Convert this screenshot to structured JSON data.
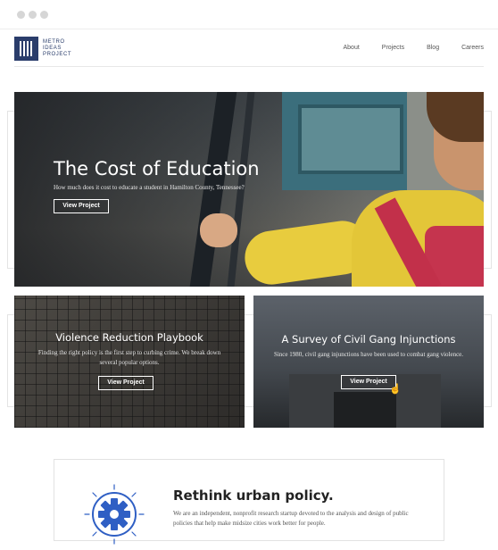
{
  "window": {
    "controls": [
      "close",
      "minimize",
      "maximize"
    ]
  },
  "logo": {
    "lines": [
      "METRO",
      "IDEAS",
      "PROJECT"
    ]
  },
  "nav": {
    "items": [
      "About",
      "Projects",
      "Blog",
      "Careers"
    ]
  },
  "hero": {
    "title": "The Cost of Education",
    "subtitle": "How much does it cost to educate a student in Hamilton County, Tennessee?",
    "button": "View Project"
  },
  "cards": [
    {
      "title": "Violence Reduction Playbook",
      "text": "Finding the right policy is the first step to curbing crime. We break down several popular options.",
      "button": "View Project"
    },
    {
      "title": "A Survey of Civil Gang Injunctions",
      "text": "Since 1980, civil gang injunctions have been used to combat gang violence.",
      "button": "View Project"
    }
  ],
  "info": {
    "icon": "gear-icon",
    "title": "Rethink urban policy.",
    "text": "We are an independent, nonprofit research startup devoted to the analysis and design of public policies that help make midsize cities work better for people."
  },
  "colors": {
    "brand": "#2a3d6b",
    "accent": "#2f5fc4"
  }
}
